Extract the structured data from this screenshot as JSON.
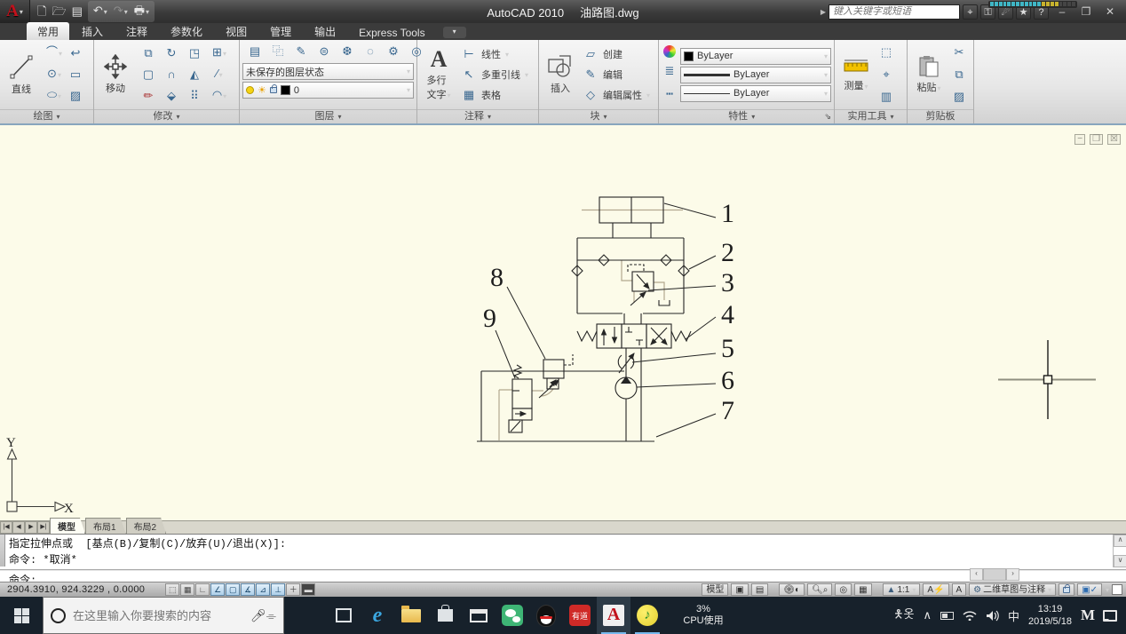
{
  "titlebar": {
    "app_title": "AutoCAD 2010",
    "doc_title": "油路图.dwg",
    "search_placeholder": "键入关键字或短语"
  },
  "ribbon_tabs": {
    "home": "常用",
    "insert": "插入",
    "annotate": "注释",
    "parametric": "参数化",
    "view": "视图",
    "manage": "管理",
    "output": "输出",
    "express": "Express Tools"
  },
  "panels": {
    "draw": {
      "footer": "绘图",
      "line": "直线"
    },
    "modify": {
      "footer": "修改",
      "move": "移动"
    },
    "layers": {
      "footer": "图层",
      "state": "未保存的图层状态",
      "layer": "0"
    },
    "annotation": {
      "footer": "注释",
      "mtext1": "多行",
      "mtext2": "文字",
      "linear": "线性",
      "mleader": "多重引线",
      "table": "表格"
    },
    "block": {
      "footer": "块",
      "insert": "插入",
      "create": "创建",
      "edit": "编辑",
      "edit_attr": "编辑属性"
    },
    "properties": {
      "footer": "特性",
      "color": "ByLayer",
      "lineweight": "ByLayer",
      "linetype": "ByLayer"
    },
    "utilities": {
      "footer": "实用工具",
      "measure": "测量"
    },
    "clipboard": {
      "footer": "剪贴板",
      "paste": "粘贴"
    }
  },
  "canvas": {
    "ucs": {
      "x": "X",
      "y": "Y"
    },
    "callouts": [
      "1",
      "2",
      "3",
      "4",
      "5",
      "6",
      "7",
      "8",
      "9"
    ]
  },
  "layout_tabs": {
    "model": "模型",
    "layout1": "布局1",
    "layout2": "布局2"
  },
  "command": {
    "line1": "指定拉伸点或  [基点(B)/复制(C)/放弃(U)/退出(X)]:",
    "line2": "命令: *取消*",
    "line3": "命令:"
  },
  "statusbar": {
    "coords": "2904.3910, 924.3229 , 0.0000",
    "model_btn": "模型",
    "scale": "1:1",
    "workspace": "二维草图与注释"
  },
  "taskbar": {
    "search_placeholder": "在这里输入你要搜索的内容",
    "youdao_label": "有道",
    "acad_label": "A",
    "cpu_pct": "3%",
    "cpu_label": "CPU使用",
    "ime": "中",
    "time": "13:19",
    "date": "2019/5/18",
    "m_label": "M"
  },
  "icons": {
    "infocenter": [
      "search-binoculars",
      "key",
      "satellite",
      "star",
      "help"
    ],
    "quick_access": [
      "new",
      "open",
      "save",
      "undo",
      "redo",
      "print"
    ],
    "status_toggles": [
      "snap",
      "grid",
      "ortho",
      "polar",
      "osnap",
      "osnap3d",
      "otrack",
      "ducs",
      "dyn",
      "lwt"
    ]
  },
  "colors": {
    "accent_red": "#c1121c",
    "canvas_bg": "#fcfbe9",
    "taskbar_bg": "#17212b",
    "toggle_on": "#aecfe9"
  }
}
